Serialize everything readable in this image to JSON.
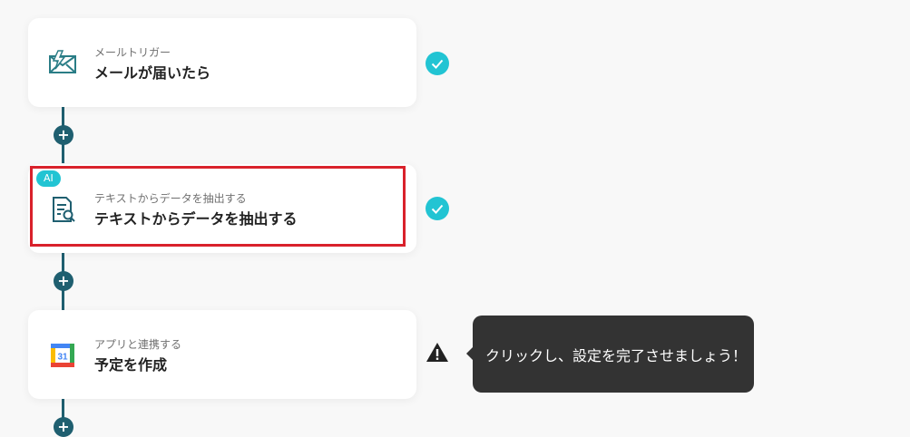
{
  "steps": [
    {
      "subtitle": "メールトリガー",
      "title": "メールが届いたら",
      "icon": "mail-trigger-icon",
      "status": "complete"
    },
    {
      "badge": "AI",
      "subtitle": "テキストからデータを抽出する",
      "title": "テキストからデータを抽出する",
      "icon": "document-search-icon",
      "status": "complete"
    },
    {
      "subtitle": "アプリと連携する",
      "title": "予定を作成",
      "icon": "google-calendar-icon",
      "calendar_day": "31",
      "status": "warning"
    }
  ],
  "add_button_symbol": "+",
  "tooltip": {
    "text": "クリックし、設定を完了させましょう！"
  },
  "colors": {
    "connector": "#1f5f70",
    "check": "#22c4d3",
    "highlight": "#d9212b",
    "tooltip_bg": "#333333"
  }
}
